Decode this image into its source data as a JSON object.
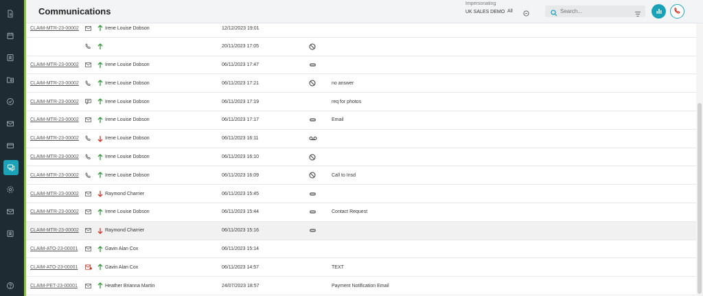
{
  "header": {
    "title": "Communications",
    "impersonating_label": "Impersonating",
    "impersonating_value": "UK SALES DEMO",
    "all_label": "All",
    "search_placeholder": "Search..."
  },
  "colors": {
    "rail": "#1f2b33",
    "accent": "#1aa3b8",
    "rail_accent": "#8cc63f",
    "outgoing": "#2e9a3a",
    "incoming": "#d93025"
  },
  "rows": [
    {
      "ref": "CLAIM-MTR-23-00002",
      "type": "email",
      "direction": "out",
      "name": "Irene Louise Dobson",
      "date": "12/12/2023 19:01",
      "status": "",
      "note": ""
    },
    {
      "ref": "",
      "type": "phone",
      "direction": "out",
      "name": "",
      "date": "20/11/2023 17:05",
      "status": "blocked",
      "note": ""
    },
    {
      "ref": "CLAIM-MTR-23-00002",
      "type": "email",
      "direction": "out",
      "name": "Irene Louise Dobson",
      "date": "06/11/2023 17:47",
      "status": "tag",
      "note": ""
    },
    {
      "ref": "CLAIM-MTR-23-00002",
      "type": "phone",
      "direction": "out",
      "name": "Irene Louise Dobson",
      "date": "06/11/2023 17:21",
      "status": "blocked",
      "note": "no answer"
    },
    {
      "ref": "CLAIM-MTR-23-00002",
      "type": "sms",
      "direction": "out",
      "name": "Irene Louise Dobson",
      "date": "06/11/2023 17:19",
      "status": "",
      "note": "req for photos"
    },
    {
      "ref": "CLAIM-MTR-23-00002",
      "type": "email",
      "direction": "out",
      "name": "Irene Louise Dobson",
      "date": "06/11/2023 17:17",
      "status": "tag",
      "note": "Email"
    },
    {
      "ref": "CLAIM-MTR-23-00002",
      "type": "phone",
      "direction": "in",
      "name": "Irene Louise Dobson",
      "date": "06/11/2023 16:11",
      "status": "voicemail",
      "note": ""
    },
    {
      "ref": "CLAIM-MTR-23-00002",
      "type": "phone",
      "direction": "out",
      "name": "Irene Louise Dobson",
      "date": "06/11/2023 16:10",
      "status": "blocked",
      "note": ""
    },
    {
      "ref": "CLAIM-MTR-23-00002",
      "type": "phone",
      "direction": "out",
      "name": "Irene Louise Dobson",
      "date": "06/11/2023 16:09",
      "status": "blocked",
      "note": "Call to Insd"
    },
    {
      "ref": "CLAIM-MTR-23-00002",
      "type": "email",
      "direction": "in",
      "name": "Raymond Charrier",
      "date": "06/11/2023 15:45",
      "status": "tag",
      "note": ""
    },
    {
      "ref": "CLAIM-MTR-23-00002",
      "type": "email",
      "direction": "out",
      "name": "Irene Louise Dobson",
      "date": "06/11/2023 15:44",
      "status": "tag",
      "note": "Contact Request"
    },
    {
      "ref": "CLAIM-MTR-23-00002",
      "type": "email",
      "direction": "in",
      "name": "Raymond Charrier",
      "date": "06/11/2023 15:16",
      "status": "tag",
      "note": ""
    },
    {
      "ref": "CLAIM-ATO-23-00001",
      "type": "email",
      "direction": "out",
      "name": "Gavin Alan Cox",
      "date": "06/11/2023 15:14",
      "status": "",
      "note": ""
    },
    {
      "ref": "CLAIM-ATO-23-00001",
      "type": "email-alert",
      "direction": "out",
      "name": "Gavin Alan Cox",
      "date": "06/11/2023 14:57",
      "status": "",
      "note": "TEXT"
    },
    {
      "ref": "CLAIM-PET-23-00001",
      "type": "email",
      "direction": "out",
      "name": "Heather Brianna Martin",
      "date": "24/07/2023 18:57",
      "status": "",
      "note": "Payment Notification Email"
    }
  ]
}
